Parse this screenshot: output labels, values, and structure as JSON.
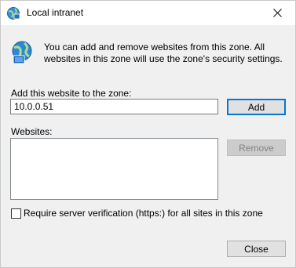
{
  "window": {
    "title": "Local intranet",
    "icon": "globe-shield-icon",
    "close_icon": "close-icon"
  },
  "description": "You can add and remove websites from this zone. All websites in this zone will use the zone's security settings.",
  "add_site": {
    "label": "Add this website to the zone:",
    "value": "10.0.0.51",
    "button_label": "Add"
  },
  "websites": {
    "label": "Websites:",
    "items": [],
    "remove_label": "Remove",
    "remove_enabled": false
  },
  "require_verification": {
    "label": "Require server verification (https:) for all sites in this zone",
    "checked": false
  },
  "footer": {
    "close_label": "Close"
  },
  "colors": {
    "accent": "#0078d7",
    "dialog_bg": "#f0f0f0"
  }
}
